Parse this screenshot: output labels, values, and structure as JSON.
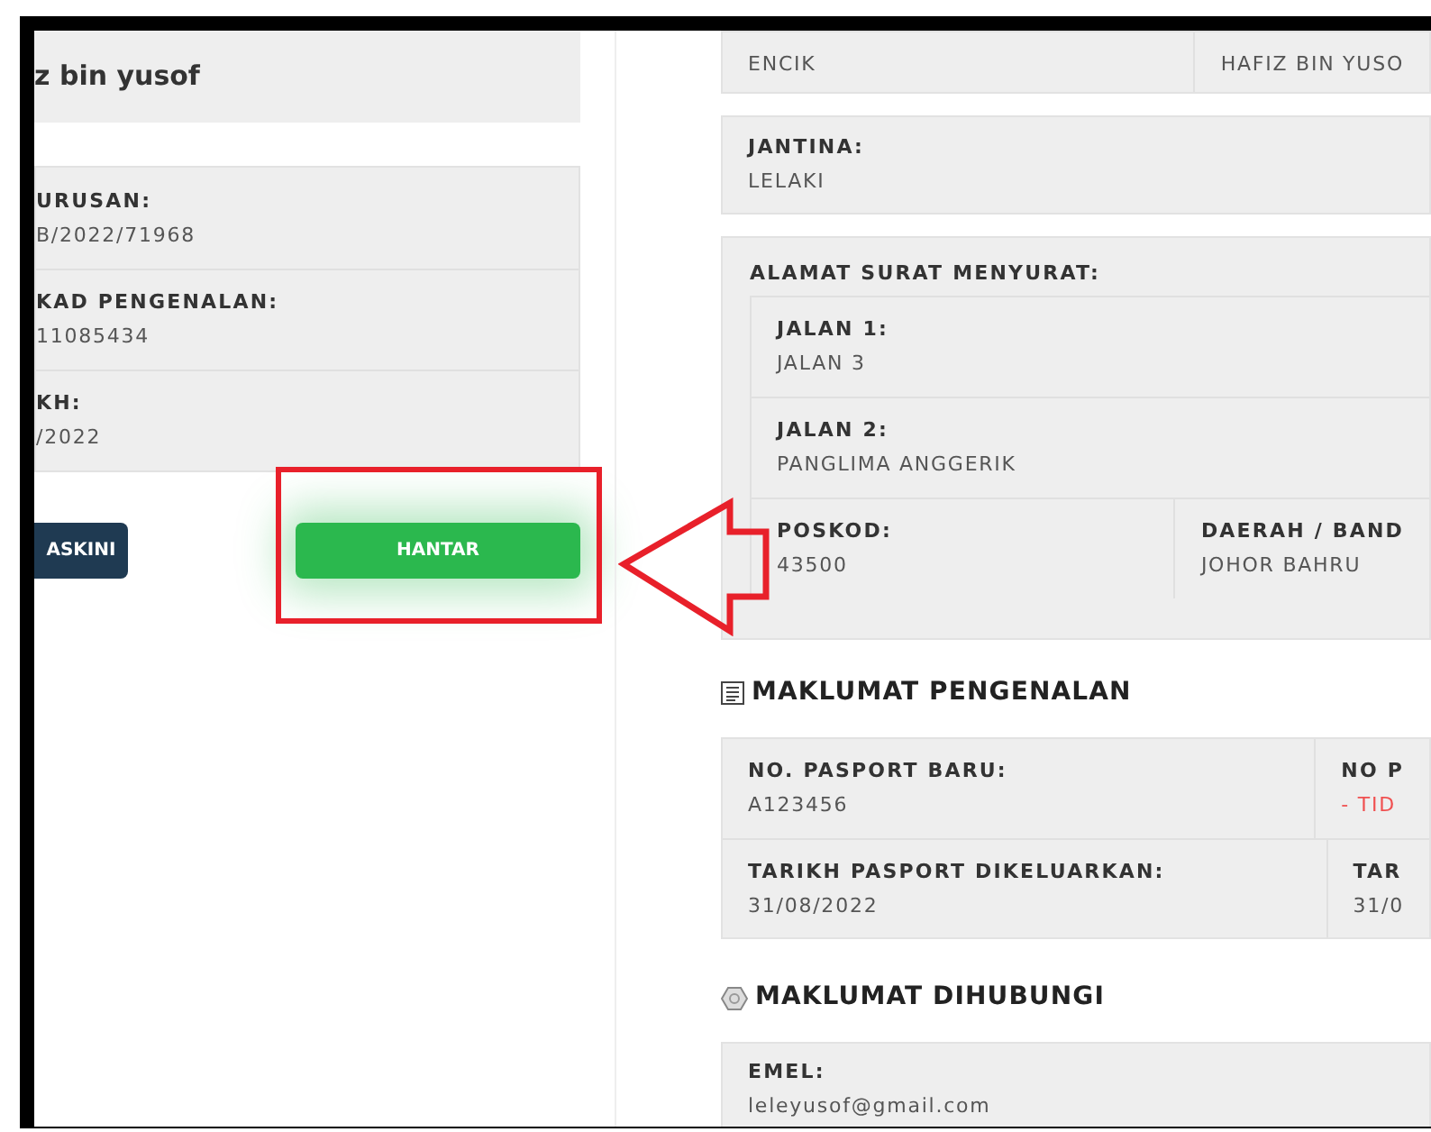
{
  "profile_name": "z bin yusof",
  "application_info": [
    {
      "label": "URUSAN:",
      "value": "B/2022/71968"
    },
    {
      "label": "KAD PENGENALAN:",
      "value": "11085434"
    },
    {
      "label": "KH:",
      "value": "/2022"
    }
  ],
  "buttons": [
    {
      "label": "ASKINI",
      "kind": "secondary"
    },
    {
      "label": "HANTAR",
      "kind": "primary"
    }
  ],
  "personal": {
    "title_row": [
      {
        "value": "ENCIK"
      },
      {
        "value": "HAFIZ BIN YUSO"
      }
    ],
    "gender": {
      "label": "JANTINA:",
      "value": "LELAKI"
    },
    "address": {
      "label": "ALAMAT SURAT MENYURAT:",
      "street_1": {
        "label": "JALAN 1:",
        "value": "JALAN 3"
      },
      "street_2": {
        "label": "JALAN 2:",
        "value": "PANGLIMA ANGGERIK"
      },
      "postcode": {
        "label": "POSKOD:",
        "value": "43500"
      },
      "district": {
        "label": "DAERAH / BAND",
        "value": "JOHOR BAHRU"
      }
    }
  },
  "identification": {
    "heading": "MAKLUMAT PENGENALAN",
    "rows": [
      [
        {
          "label": "NO. PASPORT BARU:",
          "value": "A123456",
          "missing": false
        },
        {
          "label": "NO P",
          "value": "- TID",
          "missing": true
        }
      ],
      [
        {
          "label": "TARIKH PASPORT DIKELUARKAN:",
          "value": "31/08/2022",
          "missing": false
        },
        {
          "label": "TAR",
          "value": "31/0",
          "missing": false
        }
      ]
    ]
  },
  "contact": {
    "heading": "MAKLUMAT DIHUBUNGI",
    "email": {
      "label": "EMEL:",
      "value": "leleyusof@gmail.com"
    }
  }
}
